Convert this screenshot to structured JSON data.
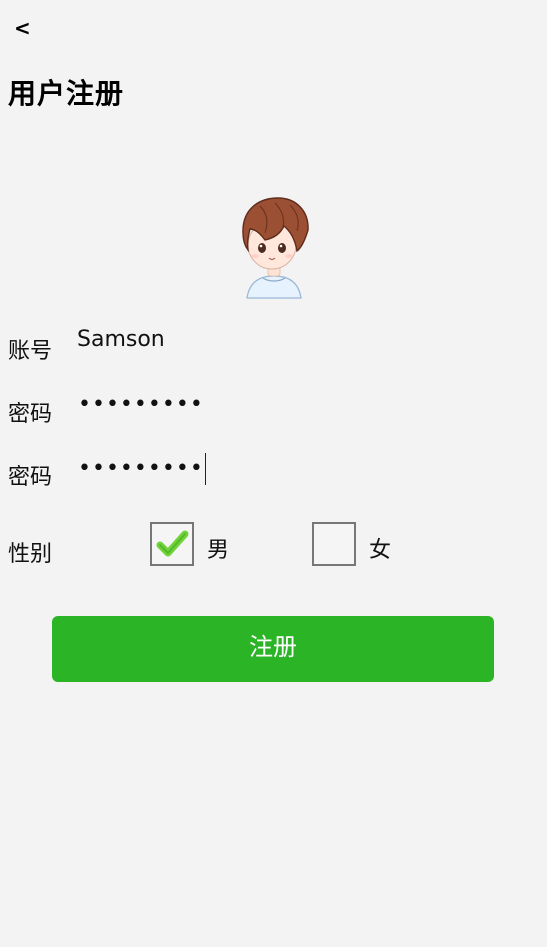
{
  "header": {
    "back_label": "<",
    "title": "用户注册"
  },
  "form": {
    "account_label": "账号",
    "account_value": "Samson",
    "password_label": "密码",
    "password_value": "•••••••••",
    "confirm_password_label": "密码",
    "confirm_password_value": "•••••••••",
    "gender_label": "性别",
    "gender_options": [
      {
        "label": "男",
        "checked": true
      },
      {
        "label": "女",
        "checked": false
      }
    ]
  },
  "actions": {
    "register_label": "注册"
  },
  "colors": {
    "background": "#f3f3f3",
    "primary_button": "#2bb425",
    "checkbox_check": "#6fd33a"
  },
  "icons": {
    "back": "back-arrow-icon",
    "avatar": "avatar-image",
    "checked": "check-mark-icon"
  }
}
